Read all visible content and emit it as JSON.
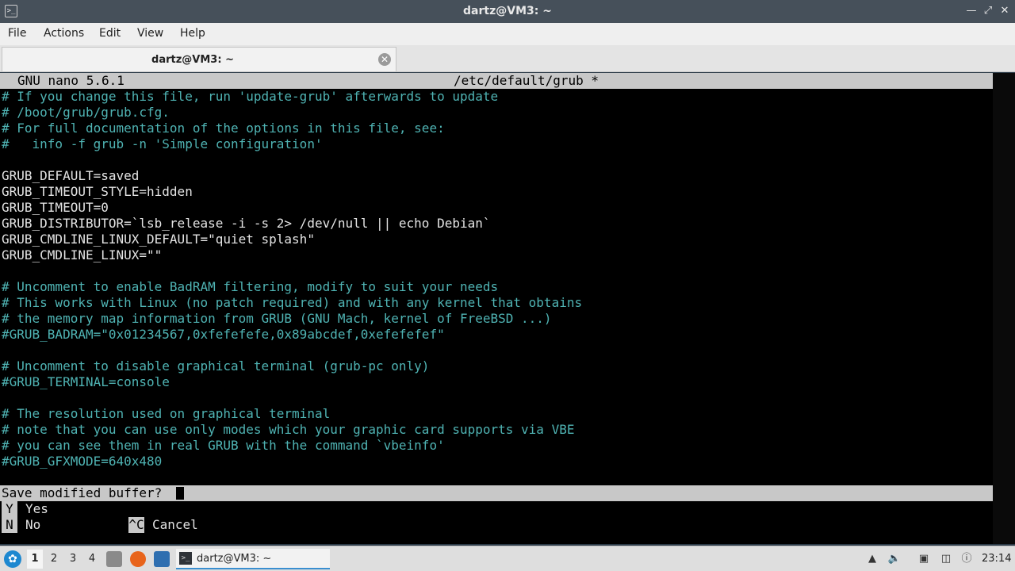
{
  "window": {
    "title": "dartz@VM3: ~",
    "icon": "terminal-icon",
    "controls": [
      "minimize",
      "maximize",
      "close"
    ]
  },
  "menu": [
    "File",
    "Actions",
    "Edit",
    "View",
    "Help"
  ],
  "tab": {
    "label": "dartz@VM3: ~",
    "close_icon": "close-circle-icon"
  },
  "nano": {
    "version": "GNU nano 5.6.1",
    "filename": "/etc/default/grub *",
    "lines": [
      {
        "text": "# If you change this file, run 'update-grub' afterwards to update",
        "kind": "comment"
      },
      {
        "text": "# /boot/grub/grub.cfg.",
        "kind": "comment"
      },
      {
        "text": "# For full documentation of the options in this file, see:",
        "kind": "comment"
      },
      {
        "text": "#   info -f grub -n 'Simple configuration'",
        "kind": "comment"
      },
      {
        "text": "",
        "kind": "plain"
      },
      {
        "text": "GRUB_DEFAULT=saved",
        "kind": "plain"
      },
      {
        "text": "GRUB_TIMEOUT_STYLE=hidden",
        "kind": "plain"
      },
      {
        "text": "GRUB_TIMEOUT=0",
        "kind": "plain"
      },
      {
        "text": "GRUB_DISTRIBUTOR=`lsb_release -i -s 2> /dev/null || echo Debian`",
        "kind": "plain"
      },
      {
        "text": "GRUB_CMDLINE_LINUX_DEFAULT=\"quiet splash\"",
        "kind": "plain"
      },
      {
        "text": "GRUB_CMDLINE_LINUX=\"\"",
        "kind": "plain"
      },
      {
        "text": "",
        "kind": "plain"
      },
      {
        "text": "# Uncomment to enable BadRAM filtering, modify to suit your needs",
        "kind": "comment"
      },
      {
        "text": "# This works with Linux (no patch required) and with any kernel that obtains",
        "kind": "comment"
      },
      {
        "text": "# the memory map information from GRUB (GNU Mach, kernel of FreeBSD ...)",
        "kind": "comment"
      },
      {
        "text": "#GRUB_BADRAM=\"0x01234567,0xfefefefe,0x89abcdef,0xefefefef\"",
        "kind": "comment"
      },
      {
        "text": "",
        "kind": "plain"
      },
      {
        "text": "# Uncomment to disable graphical terminal (grub-pc only)",
        "kind": "comment"
      },
      {
        "text": "#GRUB_TERMINAL=console",
        "kind": "comment"
      },
      {
        "text": "",
        "kind": "plain"
      },
      {
        "text": "# The resolution used on graphical terminal",
        "kind": "comment"
      },
      {
        "text": "# note that you can use only modes which your graphic card supports via VBE",
        "kind": "comment"
      },
      {
        "text": "# you can see them in real GRUB with the command `vbeinfo'",
        "kind": "comment"
      },
      {
        "text": "#GRUB_GFXMODE=640x480",
        "kind": "comment"
      }
    ],
    "prompt": "Save modified buffer?",
    "options": {
      "yes_key": "Y",
      "yes_label": "Yes",
      "no_key": "N",
      "no_label": "No",
      "cancel_key": "^C",
      "cancel_label": "Cancel"
    }
  },
  "taskbar": {
    "start_icon": "lxqt-start-icon",
    "workspaces": [
      "1",
      "2",
      "3",
      "4"
    ],
    "active_workspace": "1",
    "launchers": [
      "file-manager-icon",
      "firefox-icon",
      "show-desktop-icon"
    ],
    "task": {
      "label": "dartz@VM3: ~",
      "icon": "terminal-icon"
    },
    "tray": [
      "tray-up-arrow-icon",
      "volume-icon",
      "network-icon",
      "clipboard-icon",
      "update-notifier-icon"
    ],
    "clock": "23:14",
    "colors": {
      "firefox": "#e8641b",
      "file_manager": "#8a8a8a",
      "desktop": "#2f6fb0",
      "task_underline": "#3a8fd0"
    }
  }
}
